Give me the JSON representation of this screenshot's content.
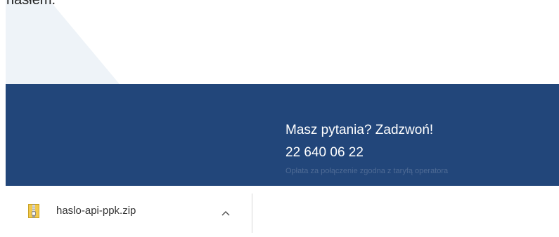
{
  "email": {
    "cropped_text": "hasłem."
  },
  "footer": {
    "question": "Masz pytania? Zadzwoń!",
    "phone": "22 640 06 22",
    "note": "Opłata za połączenie zgodna z taryfą operatora"
  },
  "downloads": {
    "items": [
      {
        "file_name": "haslo-api-ppk.zip",
        "icon": "zip-file-icon"
      }
    ]
  },
  "colors": {
    "footer_background": "#22467a",
    "footer_note": "#4f6b95",
    "decor_shape": "#eef3f8"
  }
}
